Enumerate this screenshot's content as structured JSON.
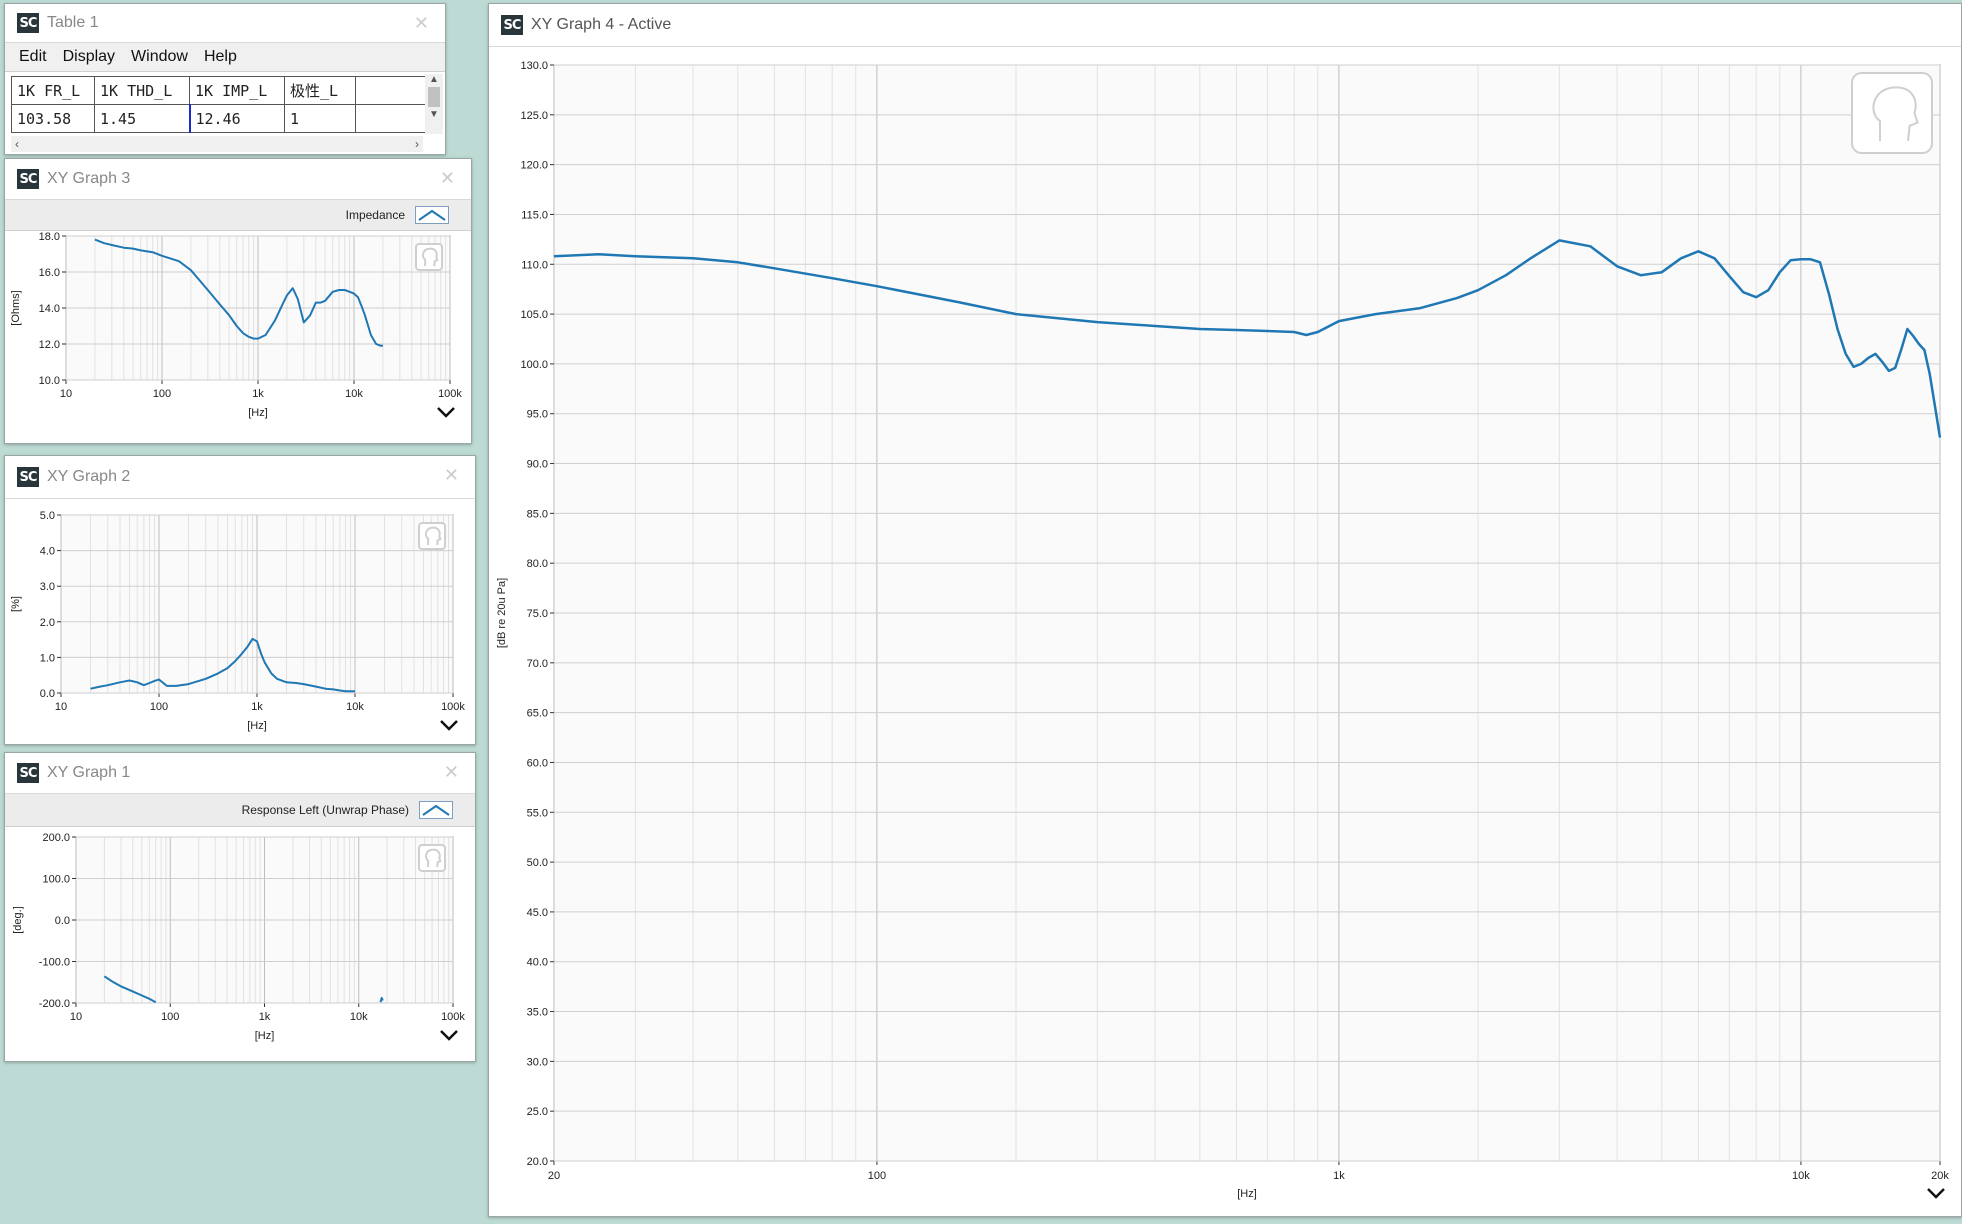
{
  "table1": {
    "title": "Table 1",
    "menu": [
      "Edit",
      "Display",
      "Window",
      "Help"
    ],
    "headers": [
      "1K FR_L",
      "1K THD_L",
      "1K IMP_L",
      "极性_L"
    ],
    "values": [
      "103.58",
      "1.45",
      "12.46",
      "1"
    ]
  },
  "graph3": {
    "title": "XY Graph 3",
    "legend": "Impedance",
    "x_label": "[Hz]",
    "y_label": "[Ohms]",
    "x_ticks": [
      "10",
      "100",
      "1k",
      "10k",
      "100k"
    ],
    "y_ticks": [
      "18.0",
      "16.0",
      "14.0",
      "12.0",
      "10.0"
    ]
  },
  "graph2": {
    "title": "XY Graph 2",
    "x_label": "[Hz]",
    "y_label": "[%]",
    "x_ticks": [
      "10",
      "100",
      "1k",
      "10k",
      "100k"
    ],
    "y_ticks": [
      "5.0",
      "4.0",
      "3.0",
      "2.0",
      "1.0",
      "0.0"
    ]
  },
  "graph1": {
    "title": "XY Graph 1",
    "legend": "Response Left (Unwrap Phase)",
    "x_label": "[Hz]",
    "y_label": "[deg.]",
    "x_ticks": [
      "10",
      "100",
      "1k",
      "10k",
      "100k"
    ],
    "y_ticks": [
      "200.0",
      "100.0",
      "0.0",
      "-100.0",
      "-200.0"
    ]
  },
  "graph4": {
    "title": "XY Graph 4 - Active",
    "x_label": "[Hz]",
    "y_label": "[dB re 20u Pa]",
    "x_ticks": [
      "20",
      "100",
      "1k",
      "10k",
      "20k"
    ],
    "y_ticks": [
      "130.0",
      "125.0",
      "120.0",
      "115.0",
      "110.0",
      "105.0",
      "100.0",
      "95.0",
      "90.0",
      "85.0",
      "80.0",
      "75.0",
      "70.0",
      "65.0",
      "60.0",
      "55.0",
      "50.0",
      "45.0",
      "40.0",
      "35.0",
      "30.0",
      "25.0",
      "20.0"
    ]
  },
  "colors": {
    "trace": "#1f77b4",
    "background": "#bddbd4",
    "grid": "#cfcfcf"
  },
  "icons": [
    "sc-app-icon",
    "close-icon",
    "chevron-down-icon",
    "headphone-head-icon",
    "scroll-up-icon",
    "scroll-down-icon",
    "scroll-left-icon",
    "scroll-right-icon"
  ],
  "chart_data": [
    {
      "type": "line",
      "id": "graph3",
      "xscale": "log",
      "xlim": [
        10,
        100000
      ],
      "ylim": [
        10,
        18
      ],
      "xlabel": "[Hz]",
      "ylabel": "[Ohms]",
      "series": [
        {
          "name": "Impedance",
          "x": [
            20,
            25,
            30,
            40,
            50,
            60,
            80,
            100,
            150,
            200,
            300,
            400,
            500,
            600,
            700,
            800,
            900,
            1000,
            1200,
            1500,
            1800,
            2000,
            2300,
            2600,
            3000,
            3500,
            4000,
            4500,
            5000,
            6000,
            7000,
            8000,
            9000,
            10000,
            11000,
            12000,
            13000,
            15000,
            17000,
            19000,
            20000
          ],
          "y": [
            17.8,
            17.6,
            17.5,
            17.35,
            17.3,
            17.2,
            17.1,
            16.9,
            16.6,
            16.1,
            15.0,
            14.2,
            13.6,
            13.0,
            12.6,
            12.4,
            12.3,
            12.3,
            12.5,
            13.3,
            14.2,
            14.7,
            15.1,
            14.5,
            13.2,
            13.6,
            14.3,
            14.3,
            14.4,
            14.9,
            15.0,
            15.0,
            14.9,
            14.8,
            14.6,
            14.1,
            13.6,
            12.5,
            12.0,
            11.9,
            11.9
          ]
        }
      ]
    },
    {
      "type": "line",
      "id": "graph2",
      "xscale": "log",
      "xlim": [
        10,
        100000
      ],
      "ylim": [
        0,
        5
      ],
      "xlabel": "[Hz]",
      "ylabel": "[%]",
      "series": [
        {
          "x": [
            20,
            25,
            30,
            40,
            50,
            60,
            70,
            80,
            90,
            100,
            120,
            150,
            200,
            300,
            400,
            500,
            600,
            700,
            800,
            900,
            1000,
            1100,
            1200,
            1400,
            1600,
            2000,
            2500,
            3000,
            4000,
            5000,
            6000,
            7000,
            8000,
            9000,
            10000
          ],
          "y": [
            0.12,
            0.18,
            0.22,
            0.3,
            0.35,
            0.3,
            0.22,
            0.28,
            0.34,
            0.38,
            0.2,
            0.2,
            0.25,
            0.4,
            0.55,
            0.7,
            0.9,
            1.1,
            1.3,
            1.52,
            1.45,
            1.1,
            0.85,
            0.55,
            0.4,
            0.3,
            0.28,
            0.25,
            0.18,
            0.12,
            0.1,
            0.07,
            0.05,
            0.05,
            0.05
          ]
        }
      ]
    },
    {
      "type": "line",
      "id": "graph1",
      "xscale": "log",
      "xlim": [
        10,
        100000
      ],
      "ylim": [
        -200,
        200
      ],
      "xlabel": "[Hz]",
      "ylabel": "[deg.]",
      "series": [
        {
          "name": "Response Left (Unwrap Phase)",
          "x": [
            20,
            25,
            30,
            40,
            50,
            60,
            70
          ],
          "y": [
            -136,
            -150,
            -160,
            -172,
            -182,
            -190,
            -198
          ]
        },
        {
          "name": "Response Left (Unwrap Phase)",
          "x": [
            17000,
            17500,
            18000
          ],
          "y": [
            -198,
            -188,
            -194
          ]
        }
      ]
    },
    {
      "type": "line",
      "id": "graph4",
      "xscale": "log",
      "xlim": [
        20,
        20000
      ],
      "ylim": [
        20,
        130
      ],
      "xlabel": "[Hz]",
      "ylabel": "[dB re 20u Pa]",
      "series": [
        {
          "x": [
            20,
            25,
            30,
            40,
            50,
            60,
            80,
            100,
            150,
            200,
            300,
            400,
            500,
            600,
            700,
            800,
            850,
            900,
            1000,
            1200,
            1500,
            1800,
            2000,
            2300,
            2600,
            3000,
            3500,
            4000,
            4500,
            5000,
            5500,
            6000,
            6500,
            7000,
            7500,
            8000,
            8500,
            9000,
            9500,
            10000,
            10500,
            11000,
            11500,
            12000,
            12500,
            13000,
            13500,
            14000,
            14500,
            15000,
            15500,
            16000,
            16500,
            17000,
            17500,
            18000,
            18500,
            19000,
            19500,
            20000
          ],
          "y": [
            110.8,
            111.0,
            110.8,
            110.6,
            110.2,
            109.6,
            108.6,
            107.8,
            106.2,
            105.0,
            104.2,
            103.8,
            103.5,
            103.4,
            103.3,
            103.2,
            102.9,
            103.2,
            104.3,
            105.0,
            105.6,
            106.6,
            107.4,
            108.9,
            110.6,
            112.4,
            111.8,
            109.8,
            108.9,
            109.2,
            110.6,
            111.3,
            110.6,
            108.8,
            107.2,
            106.7,
            107.4,
            109.2,
            110.4,
            110.5,
            110.5,
            110.2,
            107.0,
            103.5,
            101.0,
            99.7,
            100.0,
            100.6,
            101.0,
            100.2,
            99.3,
            99.6,
            101.5,
            103.5,
            102.8,
            102.0,
            101.4,
            99.0,
            95.8,
            92.6
          ]
        }
      ]
    }
  ]
}
